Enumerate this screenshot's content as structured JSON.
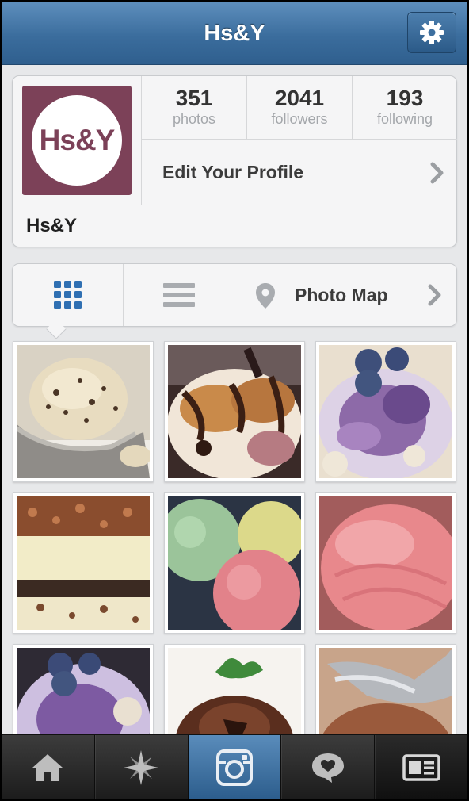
{
  "header": {
    "title": "Hs&Y",
    "settings_icon": "gear-icon"
  },
  "profile": {
    "avatar_text": "Hs&Y",
    "avatar_color": "#7c4158",
    "stats": [
      {
        "value": "351",
        "label": "photos"
      },
      {
        "value": "2041",
        "label": "followers"
      },
      {
        "value": "193",
        "label": "following"
      }
    ],
    "edit_label": "Edit Your Profile",
    "username": "Hs&Y"
  },
  "view_bar": {
    "grid_icon": "grid-view-icon",
    "list_icon": "list-view-icon",
    "map_label": "Photo Map",
    "selected": "grid"
  },
  "photos": [
    "ice-cream-scoop-chocolate-chip",
    "ice-cream-sundae-chocolate-syrup",
    "blueberry-ice-cream",
    "layered-ice-cream-cake",
    "three-ice-cream-scoops",
    "pink-ice-cream-scoop",
    "blueberry-ice-cream-scoop",
    "chocolate-ice-cream-mint",
    "chocolate-ice-cream-scooper"
  ],
  "tabbar": {
    "tabs": [
      "home-icon",
      "explore-icon",
      "camera-icon",
      "activity-icon",
      "profile-icon"
    ],
    "active": "camera-icon"
  },
  "colors": {
    "nav_blue": "#3b6d9d",
    "accent_blue": "#2f6fb2",
    "background": "#e7e8ea"
  }
}
